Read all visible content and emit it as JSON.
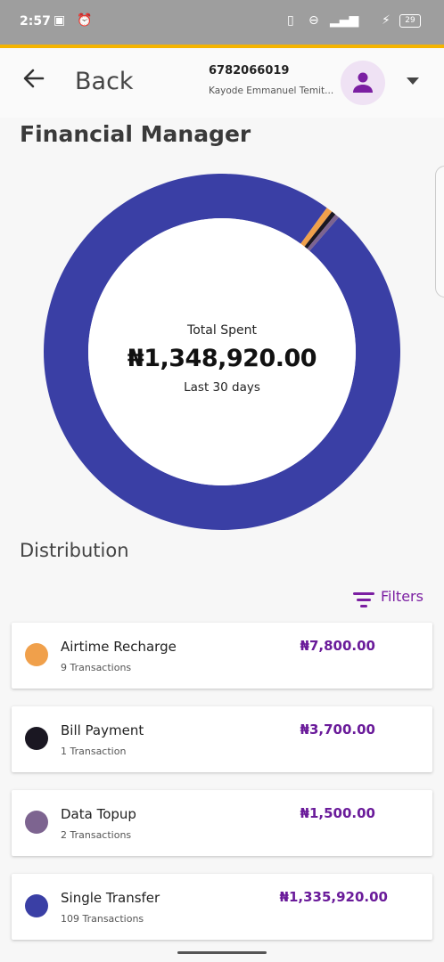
{
  "status_bar": {
    "time": "2:57",
    "battery": "29"
  },
  "header": {
    "back_label": "Back",
    "account_number": "6782066019",
    "account_name": "Kayode Emmanuel Temit..."
  },
  "page_title": "Financial Manager",
  "summary": {
    "label": "Total Spent",
    "value": "₦1,348,920.00",
    "period": "Last 30 days"
  },
  "distribution": {
    "title": "Distribution",
    "filters_label": "Filters",
    "categories": [
      {
        "name": "Airtime Recharge",
        "count": "9 Transactions",
        "amount": "₦7,800.00",
        "value": 7800,
        "color": "#f0a04b"
      },
      {
        "name": "Bill Payment",
        "count": "1 Transaction",
        "amount": "₦3,700.00",
        "value": 3700,
        "color": "#1a1722"
      },
      {
        "name": "Data Topup",
        "count": "2 Transactions",
        "amount": "₦1,500.00",
        "value": 1500,
        "color": "#7d6490"
      },
      {
        "name": "Single Transfer",
        "count": "109 Transactions",
        "amount": "₦1,335,920.00",
        "value": 1335920,
        "color": "#3a3fa5"
      }
    ]
  },
  "colors": {
    "accent": "#f4b400",
    "brand": "#7b1fa2",
    "ring_primary": "#3a3fa5"
  }
}
